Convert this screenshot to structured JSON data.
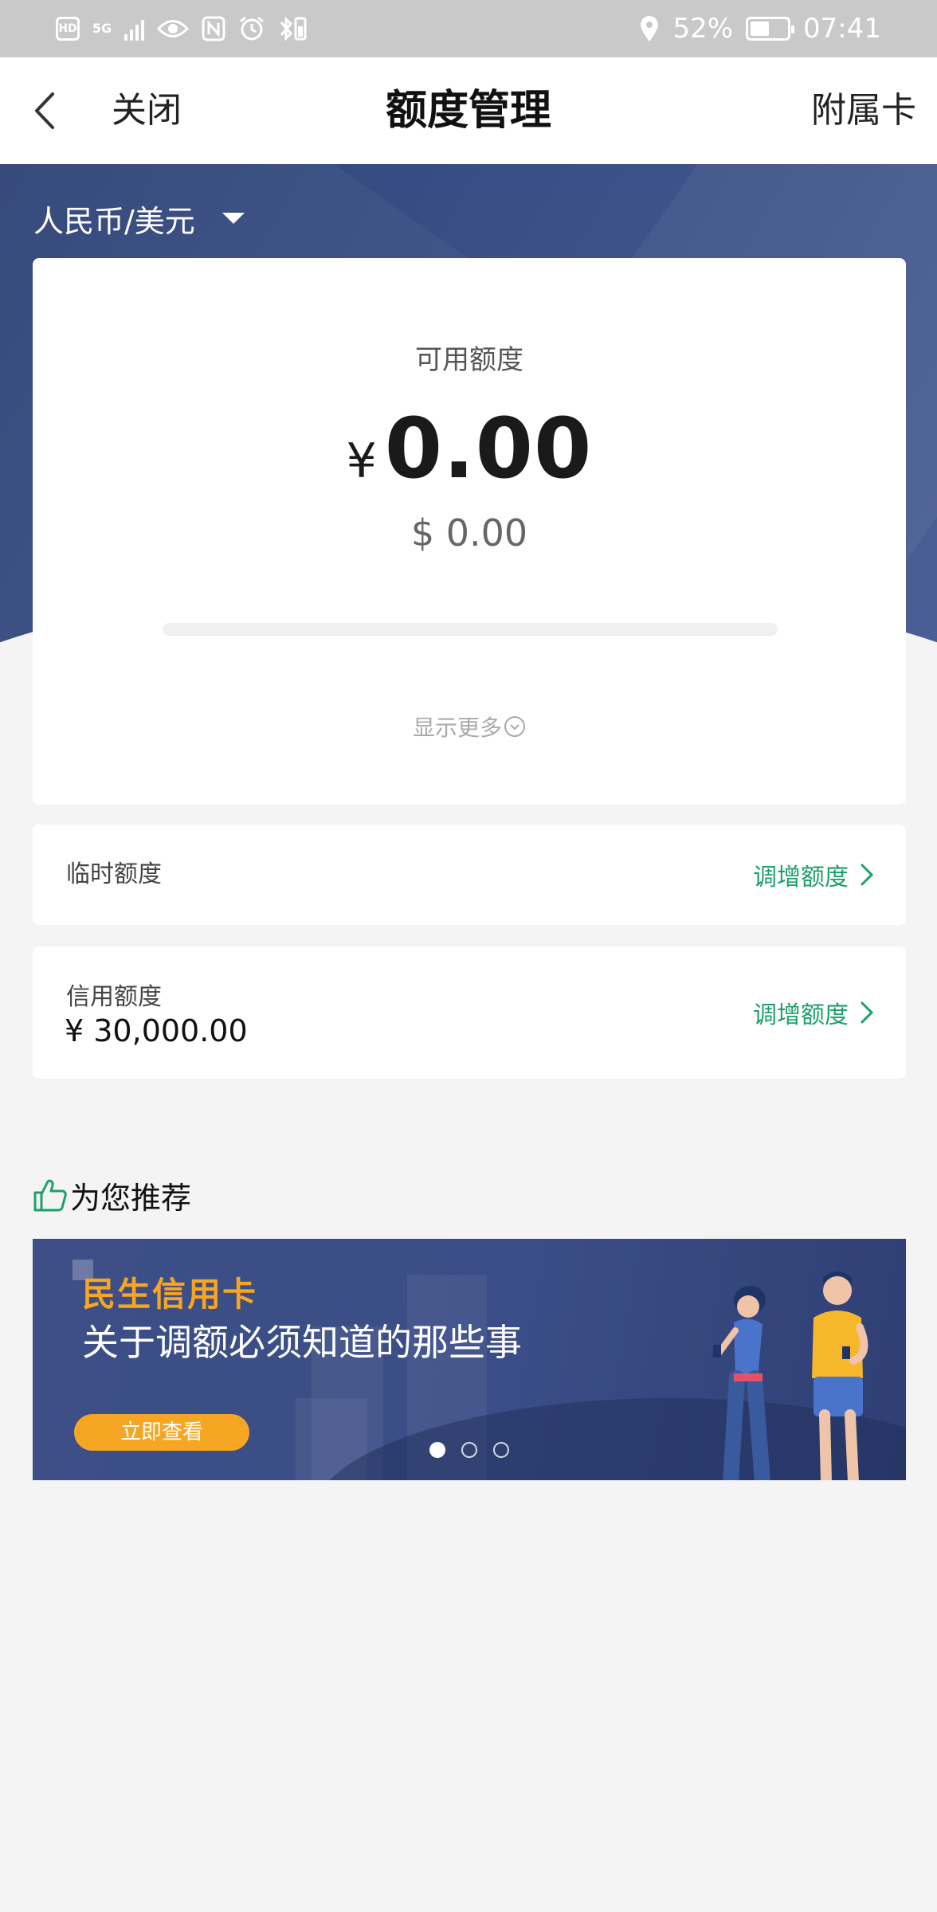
{
  "status_bar": {
    "battery_percent": "52%",
    "battery_level": 0.52,
    "time": "07:41",
    "network": "5G",
    "hd_label": "HD"
  },
  "header": {
    "close_label": "关闭",
    "title": "额度管理",
    "sub_card_label": "附属卡"
  },
  "currency": {
    "selected": "人民币/美元"
  },
  "card": {
    "available_label": "可用额度",
    "cny_symbol": "¥",
    "cny_value": "0.00",
    "usd_value": "$ 0.00",
    "usage_fraction": 0,
    "show_more_label": "显示更多"
  },
  "temp_limit": {
    "label": "临时额度",
    "action_label": "调增额度"
  },
  "credit_limit": {
    "label": "信用额度",
    "value": "¥ 30,000.00",
    "action_label": "调增额度"
  },
  "recommend": {
    "title": "为您推荐",
    "banner": {
      "brand": "民生信用卡",
      "headline": "关于调额必须知道的那些事",
      "cta": "立即查看",
      "page_count": 3,
      "active_page": 1
    }
  },
  "colors": {
    "accent_green": "#1ea06a",
    "hero_blue": "#3a4f86",
    "banner_orange": "#f7a623"
  }
}
